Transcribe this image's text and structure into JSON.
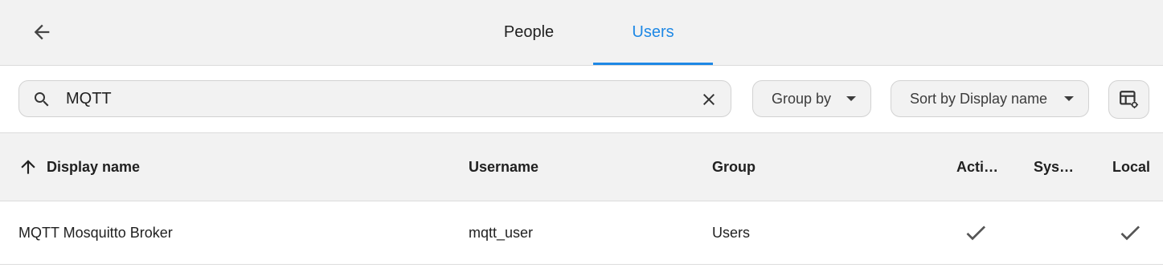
{
  "tabs": [
    {
      "label": "People",
      "active": false
    },
    {
      "label": "Users",
      "active": true
    }
  ],
  "accent_color": "#1e88e5",
  "search": {
    "value": "MQTT",
    "icon": "search-icon",
    "clear_icon": "close-icon"
  },
  "filters": {
    "group_by_label": "Group by",
    "sort_label": "Sort by Display name",
    "settings_icon": "table-settings-icon"
  },
  "table": {
    "sort_icon": "arrow-up-icon",
    "columns": [
      "Display name",
      "Username",
      "Group",
      "Acti…",
      "Sys…",
      "Local"
    ],
    "rows": [
      {
        "display_name": "MQTT Mosquitto Broker",
        "username": "mqtt_user",
        "group": "Users",
        "active": true,
        "system": false,
        "local": true
      }
    ]
  }
}
